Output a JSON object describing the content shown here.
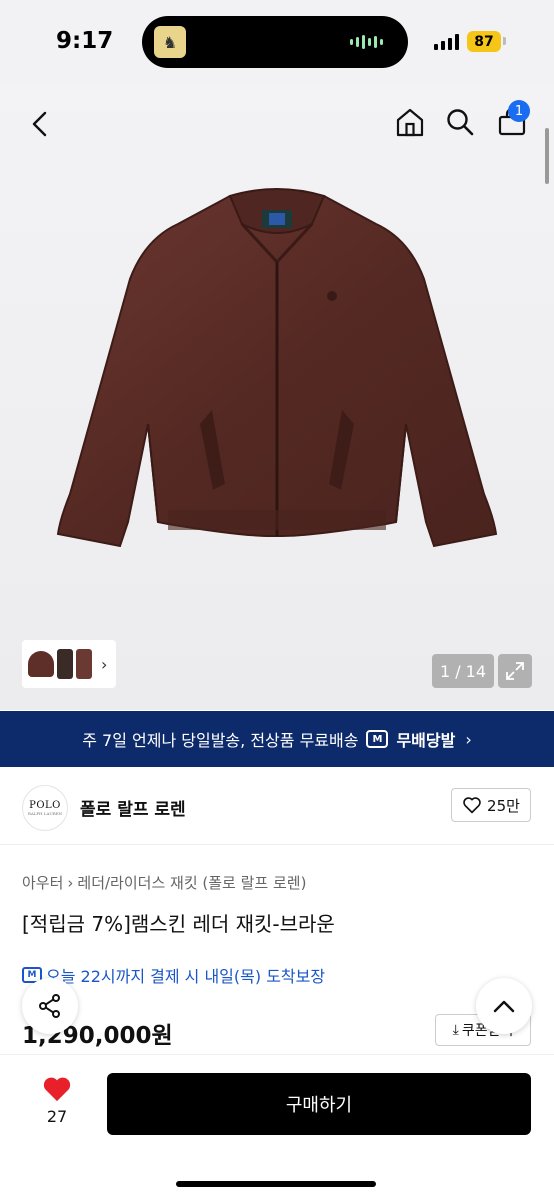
{
  "status_bar": {
    "time": "9:17",
    "battery": "87"
  },
  "header": {
    "cart_badge": "1"
  },
  "gallery": {
    "counter": "1 / 14"
  },
  "banner": {
    "text": "주 7일 언제나 당일발송, 전상품 무료배송",
    "m_icon": "M",
    "brand": "무배당발"
  },
  "brand": {
    "logo_main": "POLO",
    "logo_sub": "RALPH LAUREN",
    "name": "폴로 랄프 로렌",
    "likes": "25만"
  },
  "breadcrumb": [
    "아우터",
    "레더/라이더스 재킷 (폴로 랄프 로렌)"
  ],
  "product": {
    "title": "[적립금 7%]램스킨 레더 재킷-브라운",
    "delivery": "오늘 22시까지 결제 시 내일(목) 도착보장",
    "delivery_m": "M",
    "price": "1,290,000원",
    "coupon_label": "쿠폰받기"
  },
  "bottom": {
    "like_count": "27",
    "buy_label": "구매하기"
  },
  "colors": {
    "accent_blue": "#1a6cf0",
    "banner_navy": "#0d2a6b",
    "heart_red": "#e8202a",
    "jacket_brown": "#5e2e28"
  }
}
